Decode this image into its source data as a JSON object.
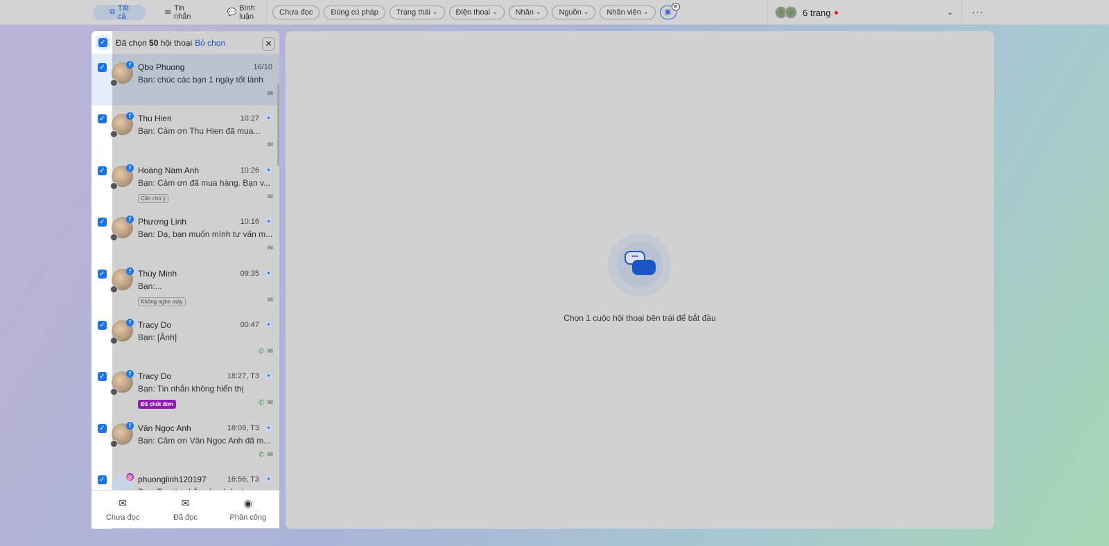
{
  "topbar": {
    "tabs": [
      {
        "label": "Tất cả",
        "icon": "chat-copy-icon",
        "active": true
      },
      {
        "label": "Tin nhắn",
        "icon": "mail-icon"
      },
      {
        "label": "Bình luận",
        "icon": "comment-icon"
      }
    ],
    "filters": [
      {
        "label": "Chưa đọc"
      },
      {
        "label": "Đúng cú pháp"
      },
      {
        "label": "Trạng thái",
        "dropdown": true
      },
      {
        "label": "Điện thoại",
        "dropdown": true
      },
      {
        "label": "Nhãn",
        "dropdown": true
      },
      {
        "label": "Nguồn",
        "dropdown": true
      },
      {
        "label": "Nhân viên",
        "dropdown": true
      }
    ],
    "pages_label": "6 trang",
    "status_dot_color": "#e02020",
    "accent": "#1a73e8"
  },
  "list": {
    "header": {
      "prefix": "Đã chọn",
      "count": "50",
      "suffix": "hội thoại",
      "deselect": "Bỏ chọn"
    },
    "items": [
      {
        "name": "Qbo Phuong",
        "time": "16/10",
        "msg": "Bạn: chúc các bạn 1 ngày tốt lành",
        "selected": true,
        "source": "facebook"
      },
      {
        "name": "Thu Hien",
        "time": "10:27",
        "msg": "Bạn: Cảm ơn Thu Hien đã mua...",
        "source": "facebook"
      },
      {
        "name": "Hoàng Nam Anh",
        "time": "10:26",
        "msg": "Bạn: Cảm ơn đã mua hàng. Bạn v...",
        "tag": "Cần chú ý",
        "source": "facebook"
      },
      {
        "name": "Phương Linh",
        "time": "10:16",
        "msg": "Bạn: Dạ, bạn muốn mình tư vấn m...",
        "source": "facebook"
      },
      {
        "name": "Thùy Minh",
        "time": "09:35",
        "msg": "Bạn:...",
        "tag": "Không nghe máy",
        "source": "facebook"
      },
      {
        "name": "Tracy Do",
        "time": "00:47",
        "msg": "Bạn: [Ảnh]",
        "phone": true,
        "source": "facebook"
      },
      {
        "name": "Tracy Do",
        "time": "18:27, T3",
        "msg": "Bạn: Tin nhắn không hiển thị",
        "tag": "Đã chốt đơn",
        "tag_color": "#8e1cb0",
        "phone": true,
        "source": "facebook"
      },
      {
        "name": "Văn Ngọc Anh",
        "time": "18:09, T3",
        "msg": "Bạn: Cảm ơn Văn Ngọc Anh đã m...",
        "phone": true,
        "source": "facebook"
      },
      {
        "name": "phuonglinh120197",
        "time": "16:56, T3",
        "msg": "Bạn: Tag tin nhắn nhanh Instagram",
        "source": "instagram"
      }
    ]
  },
  "footer": [
    {
      "label": "Chưa đọc",
      "icon": "mail-unread-icon"
    },
    {
      "label": "Đã đọc",
      "icon": "mail-open-icon"
    },
    {
      "label": "Phân công",
      "icon": "user-circle-icon"
    }
  ],
  "main": {
    "empty_text": "Chọn 1 cuộc hội thoại bên trái để bắt đầu"
  }
}
